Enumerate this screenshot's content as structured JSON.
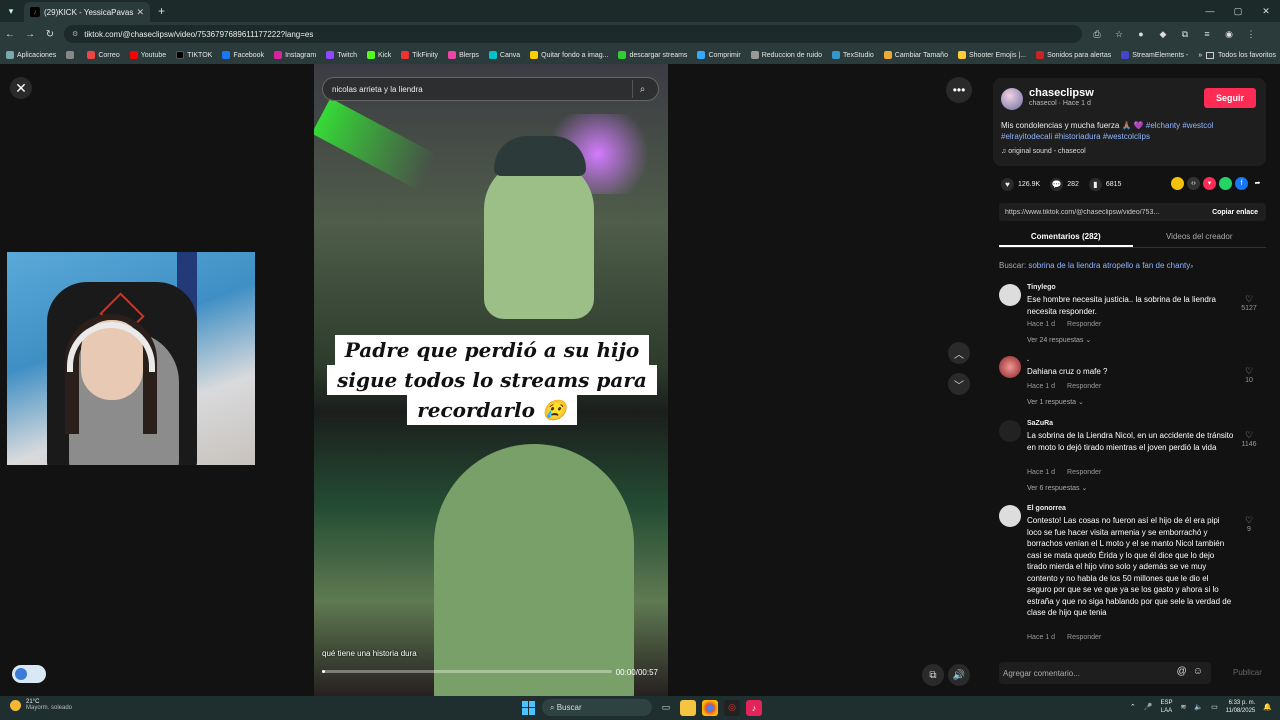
{
  "browser": {
    "tab_title": "(29)KICK - YessicaPavas 💚",
    "url": "tiktok.com/@chaseclipsw/video/7536797689611177222?lang=es",
    "bookmarks": [
      "Aplicaciones",
      "Correo",
      "Youtube",
      "TIKTOK",
      "Facebook",
      "Instagram",
      "Twitch",
      "Kick",
      "TikFinity",
      "Blerps",
      "Canva",
      "Quitar fondo a imag...",
      "descargar streams",
      "Comprimir",
      "Reduccion de ruido",
      "TexStudio",
      "Cambiar Tamaño",
      "Shooter Emojis |...",
      "Sonidos para alertas",
      "StreamElements -"
    ],
    "bookmarks_more": "»",
    "all_favorites": "Todos los favoritos"
  },
  "video": {
    "search_text": "nicolas arrieta y la liendra",
    "caption_lines": [
      "Padre que perdió a su hijo",
      "sigue todos lo  streams para",
      "recordarlo 😢"
    ],
    "subtitle": "qué tiene una historia dura",
    "time": "00:00/00:57",
    "progress": 0.0
  },
  "creator": {
    "username": "chaseclipsw",
    "sub": "chasecol · Hace 1 d",
    "follow_label": "Seguir",
    "description": "Mis condolencias y mucha fuerza 🙏🏽 💜 ",
    "hashtags": "#elchanty #westcol #elrayitodecali #historiadura #westcolclips",
    "sound": "original sound - chasecol",
    "likes": "126.9K",
    "comments": "282",
    "saves": "6815",
    "link": "https://www.tiktok.com/@chaseclipsw/video/753...",
    "copy_label": "Copiar enlace"
  },
  "tabs": {
    "comments": "Comentarios (282)",
    "creator_videos": "Videos del creador"
  },
  "search_suggestion": {
    "prefix": "Buscar:",
    "query": "sobrina de la liendra atropello a fan de chanty"
  },
  "comments": [
    {
      "user": "Tinylego",
      "text": "Ese hombre necesita justicia.. la sobrina de la liendra necesita responder.",
      "time": "Hace 1 d",
      "reply": "Responder",
      "replies": "Ver 24 respuestas",
      "likes": "5127"
    },
    {
      "user": ".",
      "text": "Dahiana cruz o mafe ?",
      "time": "Hace 1 d",
      "reply": "Responder",
      "replies": "Ver 1 respuesta",
      "likes": "10"
    },
    {
      "user": "SaZuRa",
      "text": "La sobrina de la Liendra Nicol, en un accidente de tránsito en moto lo dejó tirado mientras el joven perdió la vida",
      "time": "Hace 1 d",
      "reply": "Responder",
      "replies": "Ver 6 respuestas",
      "likes": "1146"
    },
    {
      "user": "El gonorrea",
      "text": "Contesto! Las cosas no fueron así el hijo de él era pipi loco se fue hacer visita armenia y se emborrachó y borrachos venían el L moto y el se manto Nicol también casi se mata quedo Érida y lo que él dice que lo dejo tirado mierda el hijo vino solo y además se ve muy contento y no habla de los 50 millones que le dio el seguro por que se ve que ya se los gasto y ahora si lo estraña y que no siga hablando por que sele la verdad de clase de hijo que tenia",
      "time": "Hace 1 d",
      "reply": "Responder",
      "replies": "",
      "likes": "9"
    }
  ],
  "comment_box": {
    "placeholder": "Agregar comentario...",
    "publish": "Publicar"
  },
  "taskbar": {
    "temp": "21°C",
    "weather": "Mayorm. soleado",
    "search": "Buscar",
    "lang1": "ESP",
    "lang2": "LAA",
    "time": "6:33 p. m.",
    "date": "11/08/2025"
  },
  "colors": {
    "accent": "#fe2c55",
    "link": "#8fb5ff"
  }
}
